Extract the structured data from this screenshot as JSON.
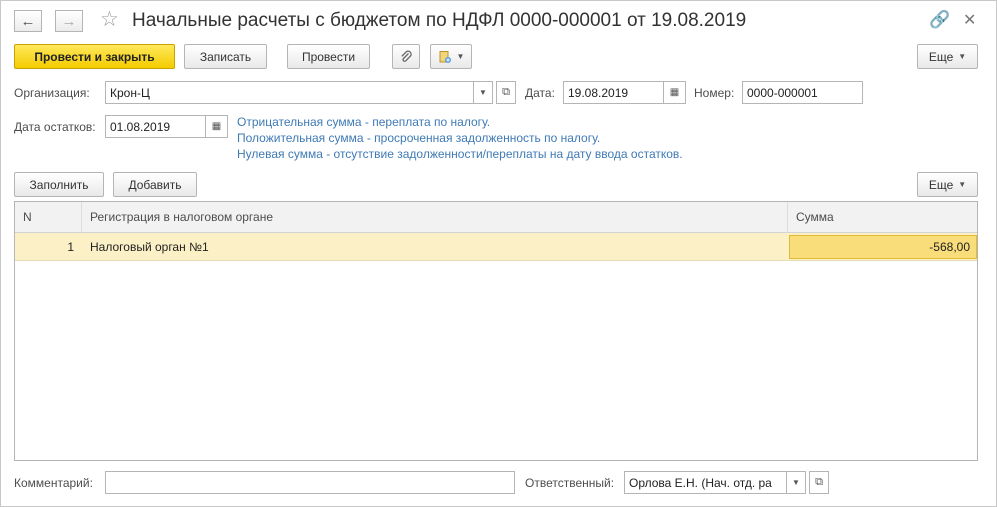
{
  "window": {
    "title": "Начальные расчеты с бюджетом по НДФЛ 0000-000001 от 19.08.2019"
  },
  "toolbar": {
    "post_and_close": "Провести и закрыть",
    "save": "Записать",
    "post": "Провести",
    "more": "Еще"
  },
  "form": {
    "organization_label": "Организация:",
    "organization_value": "Крон-Ц",
    "date_label": "Дата:",
    "date_value": "19.08.2019",
    "number_label": "Номер:",
    "number_value": "0000-000001",
    "balance_date_label": "Дата остатков:",
    "balance_date_value": "01.08.2019",
    "hints": [
      "Отрицательная сумма - переплата по налогу.",
      "Положительная сумма - просроченная задолженность по налогу.",
      "Нулевая сумма - отсутствие задолженности/переплаты на дату ввода остатков."
    ]
  },
  "table_toolbar": {
    "fill": "Заполнить",
    "add": "Добавить",
    "more": "Еще"
  },
  "table": {
    "columns": [
      "N",
      "Регистрация в налоговом органе",
      "Сумма"
    ],
    "rows": [
      {
        "n": "1",
        "registration": "Налоговый орган №1",
        "sum": "-568,00"
      }
    ]
  },
  "footer": {
    "comment_label": "Комментарий:",
    "comment_value": "",
    "responsible_label": "Ответственный:",
    "responsible_value": "Орлова Е.Н. (Нач. отд. ра"
  },
  "colors": {
    "primary_button": "#f4cc00",
    "hint_text": "#3f7ab5",
    "selected_row": "#fbf0c6",
    "selected_cell": "#f9dd7a"
  }
}
